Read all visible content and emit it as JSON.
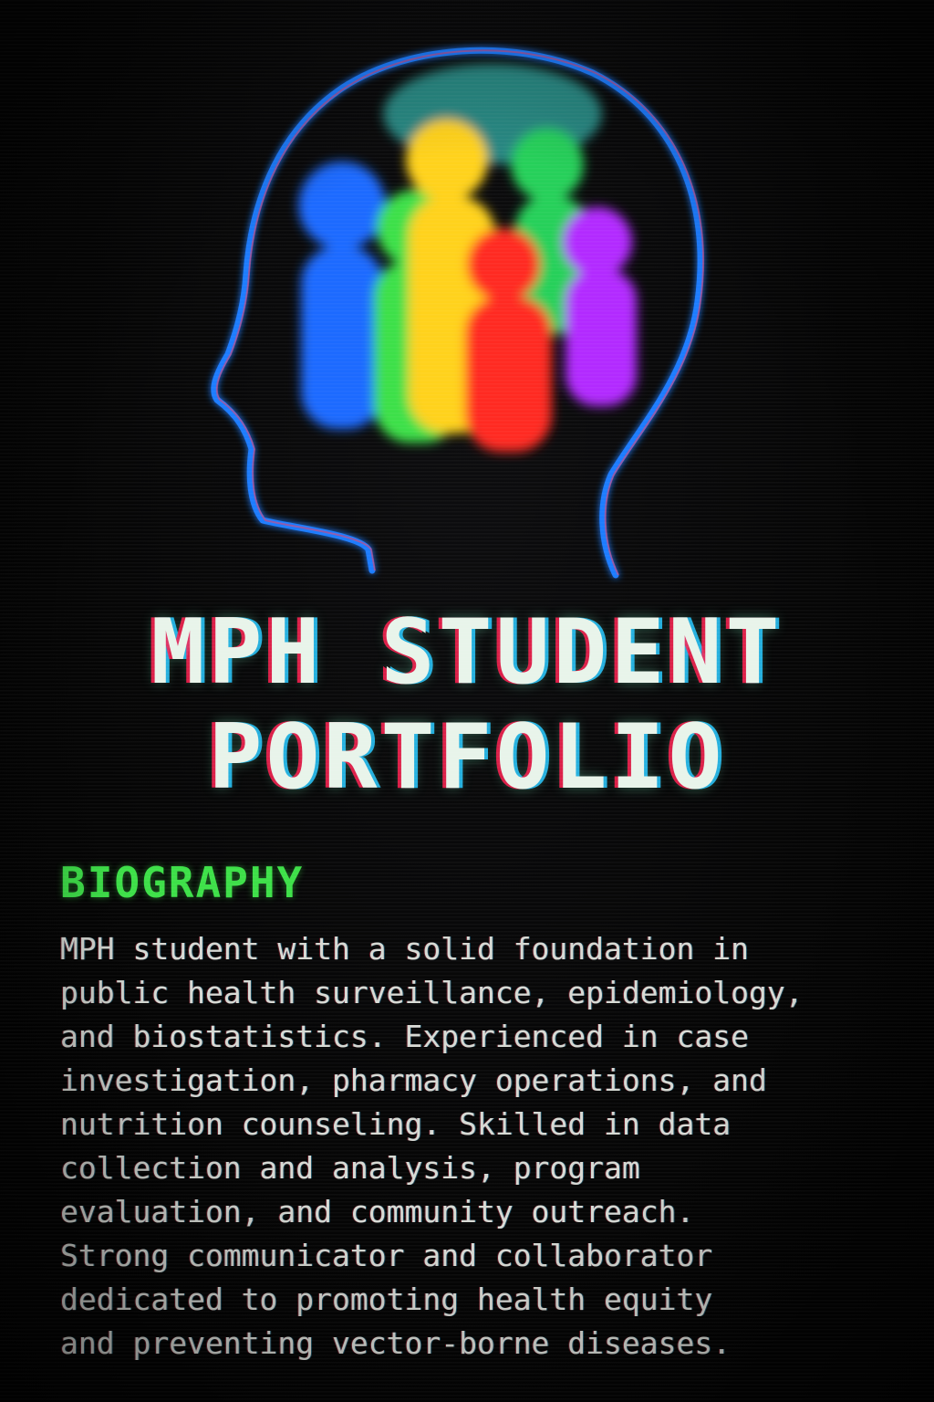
{
  "hero": {
    "icon": "head-silhouette-with-colorful-people-icon",
    "colors": {
      "outline": "#1e7bff",
      "people": [
        "#1f6bff",
        "#ffd21e",
        "#3ee04a",
        "#ff2a20",
        "#b22bff",
        "#27d05a"
      ]
    }
  },
  "title": {
    "line1": "MPH STUDENT",
    "line2": "PORTFOLIO"
  },
  "biography": {
    "heading": "BIOGRAPHY",
    "lines": [
      "MPH student with a solid foundation in",
      "public health surveillance, epidemiology,",
      "and biostatistics. Experienced in case",
      "investigation, pharmacy operations, and",
      "nutrition counseling. Skilled in data",
      "collection and analysis, program",
      "evaluation, and community outreach.",
      "Strong communicator and collaborator",
      "dedicated to promoting health equity",
      "and preventing vector-borne diseases."
    ]
  },
  "colors": {
    "background": "#050505",
    "heading": "#3de048",
    "body_text": "#d7dad4",
    "title_text": "#e8f4ea"
  }
}
